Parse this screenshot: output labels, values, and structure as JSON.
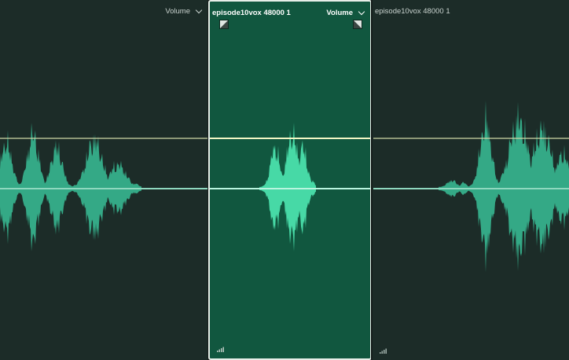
{
  "clips": [
    {
      "name": "",
      "effect": "Volume",
      "selected": false
    },
    {
      "name": "episode10vox 48000 1",
      "effect": "Volume",
      "selected": true
    },
    {
      "name": "episode10vox 48000 1",
      "effect": "",
      "selected": false
    }
  ],
  "icons": {
    "fade_in": "fade-in-handle-icon",
    "fade_out": "fade-out-handle-icon",
    "menu": "chevron-down-icon",
    "meter": "level-meter-icon"
  },
  "colors": {
    "track_background": "#1c2c28",
    "selected_clip_background": "#11573f",
    "waveform": "#34a986",
    "waveform_selected": "#47d9a6",
    "volume_line": "#e8f0b8",
    "center_line": "#8fd8bf"
  }
}
